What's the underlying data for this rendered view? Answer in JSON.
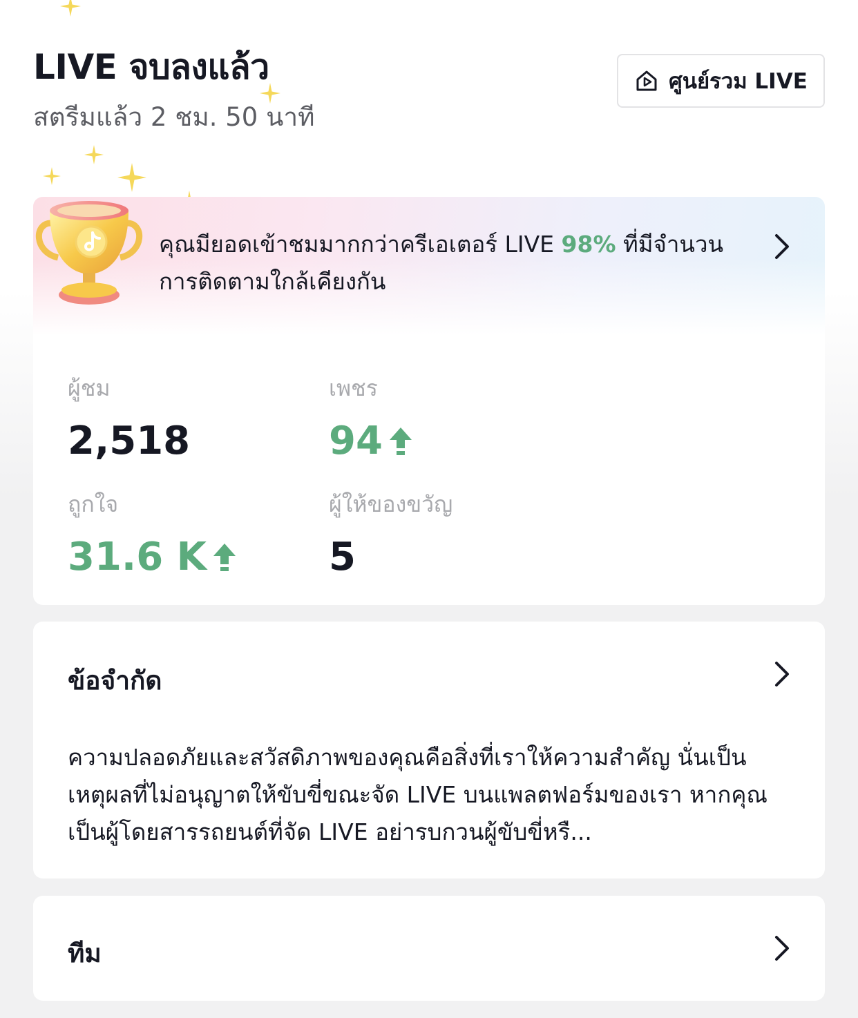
{
  "header": {
    "title": "LIVE จบลงแล้ว",
    "subtitle": "สตรีมแล้ว 2 ชม. 50 นาที",
    "hub_button_label": "ศูนย์รวม LIVE",
    "hub_button_icon": "home-play-icon"
  },
  "banner": {
    "text_before": "คุณมียอดเข้าชมมากกว่าครีเอเตอร์ LIVE ",
    "percent": "98%",
    "text_after": " ที่มีจำนวนการติดตามใกล้เคียงกัน",
    "icon": "trophy-icon",
    "accent_color": "#5cab7d"
  },
  "stats": {
    "viewers": {
      "label": "ผู้ชม",
      "value": "2,518"
    },
    "diamonds": {
      "label": "เพชร",
      "value": "94",
      "trend": "up"
    },
    "likes": {
      "label": "ถูกใจ",
      "value": "31.6 K",
      "trend": "up"
    },
    "gifters": {
      "label": "ผู้ให้ของขวัญ",
      "value": "5"
    }
  },
  "restrictions": {
    "title": "ข้อจำกัด",
    "body": "ความปลอดภัยและสวัสดิภาพของคุณคือสิ่งที่เราให้ความสำคัญ นั่นเป็นเหตุผลที่ไม่อนุญาตให้ขับขี่ขณะจัด LIVE บนแพลตฟอร์มของเรา หากคุณเป็นผู้โดยสารรถยนต์ที่จัด LIVE อย่ารบกวนผู้ขับขี่หรื..."
  },
  "team": {
    "title": "ทีม"
  },
  "colors": {
    "positive": "#5cab7d",
    "sparkle": "#f5d85a",
    "text_primary": "#161823",
    "text_secondary": "#a8a9ad"
  }
}
